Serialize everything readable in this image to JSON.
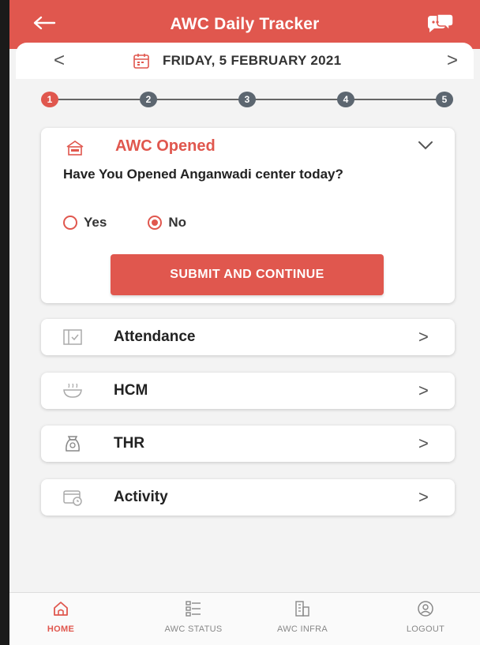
{
  "header": {
    "title": "AWC Daily Tracker",
    "back_icon": "arrow-left-icon",
    "chat_icon": "chat-bubbles-icon"
  },
  "date_bar": {
    "date": "FRIDAY, 5 FEBRUARY 2021",
    "prev": "<",
    "next": ">"
  },
  "stepper": {
    "steps": [
      "1",
      "2",
      "3",
      "4",
      "5"
    ],
    "active_step": "1"
  },
  "awc_opened": {
    "title": "AWC Opened",
    "question": "Have You Opened Anganwadi center today?",
    "options": [
      "Yes",
      "No"
    ],
    "selected": "No",
    "submit_label": "SUBMIT AND CONTINUE"
  },
  "sections": [
    {
      "label": "Attendance",
      "icon": "attendance-icon",
      "chevron": ">"
    },
    {
      "label": "HCM",
      "icon": "meal-bowl-icon",
      "chevron": ">"
    },
    {
      "label": "THR",
      "icon": "ration-bag-icon",
      "chevron": ">"
    },
    {
      "label": "Activity",
      "icon": "activity-icon",
      "chevron": ">"
    }
  ],
  "bottom_nav": [
    {
      "label": "HOME",
      "icon": "home-icon",
      "active": true
    },
    {
      "label": "AWC STATUS",
      "icon": "status-list-icon",
      "active": false
    },
    {
      "label": "AWC INFRA",
      "icon": "building-icon",
      "active": false
    },
    {
      "label": "LOGOUT",
      "icon": "logout-icon",
      "active": false
    }
  ],
  "colors": {
    "accent": "#e0574e",
    "step_inactive": "#5c6670",
    "background": "#f3f3f3"
  }
}
